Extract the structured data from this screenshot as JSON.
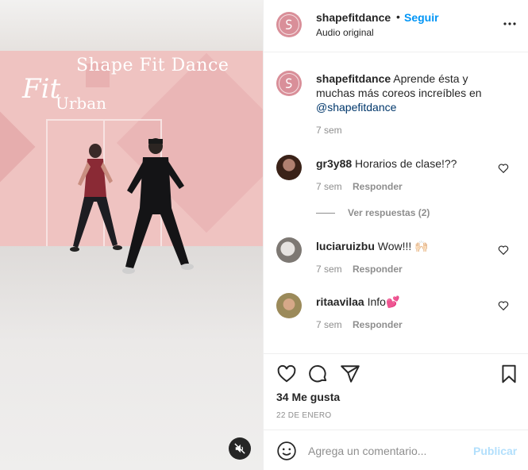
{
  "media": {
    "overlay_title": "Shape Fit Dance",
    "overlay_script": "Fit",
    "overlay_sub": "Urban",
    "mute_icon": "speaker-muted-icon"
  },
  "header": {
    "username": "shapefitdance",
    "separator": "•",
    "follow_label": "Seguir",
    "audio": "Audio original",
    "more_icon": "more-horizontal-icon"
  },
  "caption": {
    "username": "shapefitdance",
    "text": "Aprende ésta y muchas más coreos increíbles en",
    "mention": "@shapefitdance",
    "time": "7 sem"
  },
  "comments": [
    {
      "username": "gr3y88",
      "text": "Horarios de clase!??",
      "time": "7 sem",
      "reply_label": "Responder"
    },
    {
      "username": "luciaruizbu",
      "text": "Wow!!! 🙌🏻",
      "time": "7 sem",
      "reply_label": "Responder"
    },
    {
      "username": "ritaavilaa",
      "text": "Info💕",
      "time": "7 sem",
      "reply_label": "Responder"
    }
  ],
  "view_replies": "Ver respuestas (2)",
  "actions": {
    "likes": "34 Me gusta",
    "date": "22 DE ENERO"
  },
  "composer": {
    "placeholder": "Agrega un comentario...",
    "publish_label": "Publicar"
  },
  "colors": {
    "link_blue": "#0095f6",
    "publish_disabled": "#b2dffc",
    "brand_avatar": "#d98f99",
    "muted_text": "#8e8e8e"
  }
}
